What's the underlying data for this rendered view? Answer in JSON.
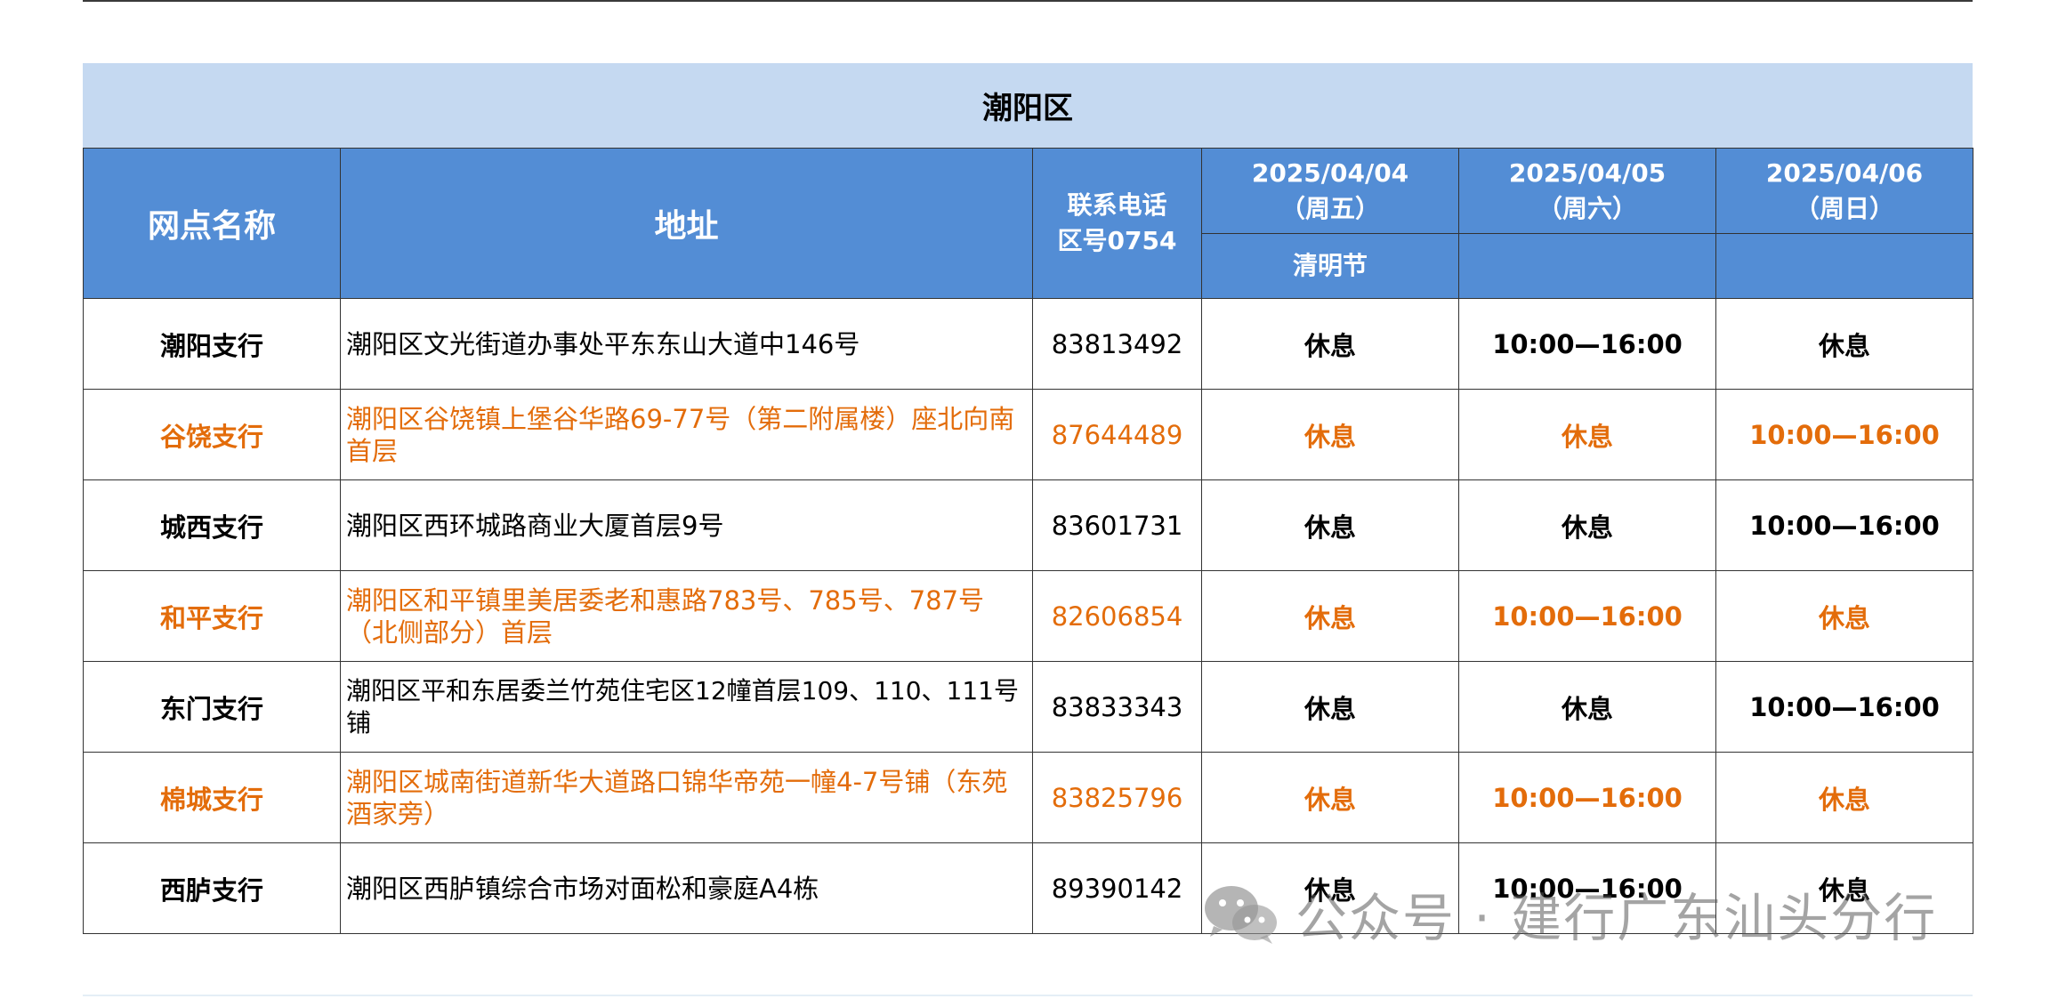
{
  "region": "潮阳区",
  "headers": {
    "name": "网点名称",
    "address": "地址",
    "phone": "联系电话\n区号0754",
    "days": [
      {
        "date": "2025/04/04",
        "weekday": "（周五）",
        "holiday": "清明节"
      },
      {
        "date": "2025/04/05",
        "weekday": "（周六）",
        "holiday": ""
      },
      {
        "date": "2025/04/06",
        "weekday": "（周日）",
        "holiday": ""
      }
    ]
  },
  "rows": [
    {
      "name": "潮阳支行",
      "address": "潮阳区文光街道办事处平东东山大道中146号",
      "phone": "83813492",
      "d1": "休息",
      "d2": "10:00—16:00",
      "d3": "休息"
    },
    {
      "name": "谷饶支行",
      "address": "潮阳区谷饶镇上堡谷华路69-77号（第二附属楼）座北向南首层",
      "phone": "87644489",
      "d1": "休息",
      "d2": "休息",
      "d3": "10:00—16:00"
    },
    {
      "name": "城西支行",
      "address": "潮阳区西环城路商业大厦首层9号",
      "phone": "83601731",
      "d1": "休息",
      "d2": "休息",
      "d3": "10:00—16:00"
    },
    {
      "name": "和平支行",
      "address": "潮阳区和平镇里美居委老和惠路783号、785号、787号（北侧部分）首层",
      "phone": "82606854",
      "d1": "休息",
      "d2": "10:00—16:00",
      "d3": "休息"
    },
    {
      "name": "东门支行",
      "address": "潮阳区平和东居委兰竹苑住宅区12幢首层109、110、111号铺",
      "phone": "83833343",
      "d1": "休息",
      "d2": "休息",
      "d3": "10:00—16:00"
    },
    {
      "name": "棉城支行",
      "address": "潮阳区城南街道新华大道路口锦华帝苑一幢4-7号铺（东苑酒家旁）",
      "phone": "83825796",
      "d1": "休息",
      "d2": "10:00—16:00",
      "d3": "休息"
    },
    {
      "name": "西胪支行",
      "address": "潮阳区西胪镇综合市场对面松和豪庭A4栋",
      "phone": "89390142",
      "d1": "休息",
      "d2": "10:00—16:00",
      "d3": "休息"
    }
  ],
  "watermark": {
    "text": "公众号 · 建行广东汕头分行",
    "icon": "wechat-icon"
  },
  "colors": {
    "header_bg": "#538dd5",
    "title_bg": "#c5d9f1",
    "alt_text": "#e36c0a"
  }
}
